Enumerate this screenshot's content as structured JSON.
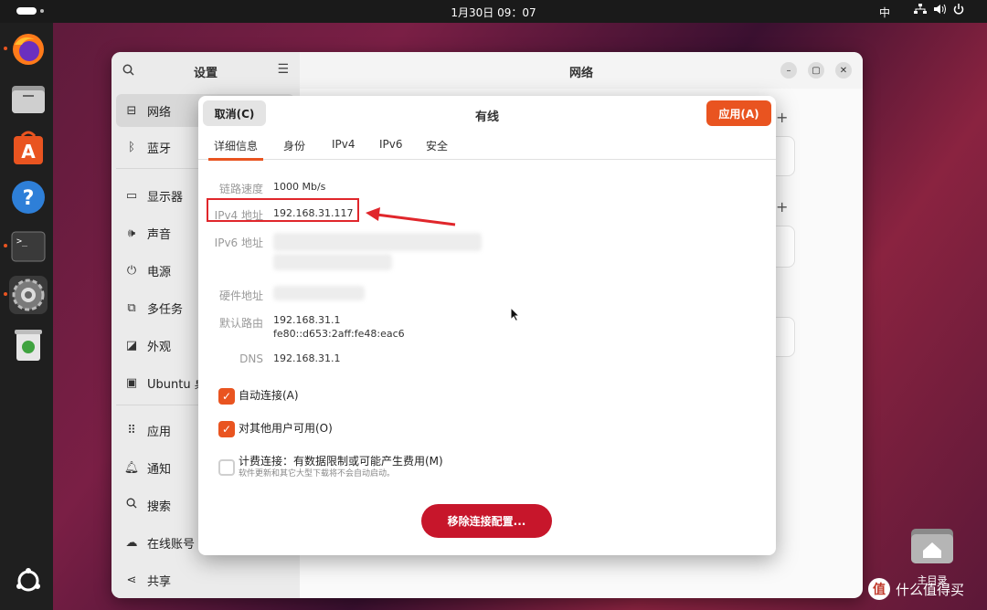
{
  "topbar": {
    "clock": "1月30日 09：07",
    "ime": "中"
  },
  "dock": {
    "apps": [
      "firefox-icon",
      "files-icon",
      "app-center-icon",
      "help-icon",
      "terminal-icon",
      "settings-icon",
      "trash-icon"
    ],
    "show_apps": "ubuntu-logo-icon"
  },
  "settings": {
    "sidebar_title": "设置",
    "main_title": "网络",
    "sidebar_items": [
      {
        "label": "网络",
        "icon": "network-icon"
      },
      {
        "label": "蓝牙",
        "icon": "bluetooth-icon"
      },
      {
        "label": "显示器",
        "icon": "display-icon"
      },
      {
        "label": "声音",
        "icon": "sound-icon"
      },
      {
        "label": "电源",
        "icon": "power-icon"
      },
      {
        "label": "多任务",
        "icon": "multitasking-icon"
      },
      {
        "label": "外观",
        "icon": "appearance-icon"
      },
      {
        "label": "Ubuntu 桌",
        "icon": "ubuntu-desktop-icon"
      },
      {
        "label": "应用",
        "icon": "apps-icon"
      },
      {
        "label": "通知",
        "icon": "bell-icon"
      },
      {
        "label": "搜索",
        "icon": "search-icon"
      },
      {
        "label": "在线账号",
        "icon": "cloud-icon"
      },
      {
        "label": "共享",
        "icon": "share-icon"
      }
    ]
  },
  "dialog": {
    "cancel_label": "取消(C)",
    "title": "有线",
    "apply_label": "应用(A)",
    "tabs": [
      "详细信息",
      "身份",
      "IPv4",
      "IPv6",
      "安全"
    ],
    "details": {
      "link_speed_label": "链路速度",
      "link_speed": "1000 Mb/s",
      "ipv4_label": "IPv4 地址",
      "ipv4": "192.168.31.117",
      "ipv6_label": "IPv6 地址",
      "ipv6": "",
      "hw_label": "硬件地址",
      "hw": "",
      "route_label": "默认路由",
      "route_v4": "192.168.31.1",
      "route_v6": "fe80::d653:2aff:fe48:eac6",
      "dns_label": "DNS",
      "dns": "192.168.31.1"
    },
    "auto_connect": {
      "label": "自动连接(A)",
      "checked": true
    },
    "all_users": {
      "label": "对其他用户可用(O)",
      "checked": true
    },
    "metered": {
      "label": "计费连接：有数据限制或可能产生费用(M)",
      "sublabel": "软件更新和其它大型下载将不会自动启动。",
      "checked": false
    },
    "remove_label": "移除连接配置..."
  },
  "desktop": {
    "home_label": "主目录",
    "watermark": "什么值得买"
  },
  "colors": {
    "accent": "#e95420",
    "destructive": "#c7162b",
    "highlight": "#e0262b"
  }
}
